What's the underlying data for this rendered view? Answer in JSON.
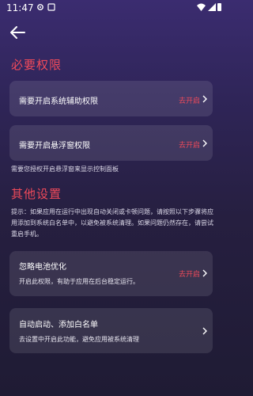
{
  "status": {
    "time": "11:47"
  },
  "header": {
    "back_icon": "arrow-left-icon"
  },
  "required": {
    "title": "必要权限",
    "items": [
      {
        "title": "需要开启系统辅助权限",
        "action": "去开启"
      },
      {
        "title": "需要开启悬浮窗权限",
        "action": "去开启"
      }
    ],
    "note": "需要您授权开启悬浮窗来显示控制面板"
  },
  "other": {
    "title": "其他设置",
    "tip": "提示：如果应用在运行中出现自动关闭或卡顿问题，请按照以下步骤将应用添加到系统白名单中，以避免被系统清理。如果问题仍然存在，请尝试重启手机。",
    "items": [
      {
        "title": "忽略电池优化",
        "desc": "开启此权限，有助于应用在后台稳定运行。",
        "action": "去开启"
      },
      {
        "title": "自动启动、添加白名单",
        "desc": "去设置中开启此功能，避免应用被系统清理",
        "action": ""
      }
    ]
  },
  "colors": {
    "accent": "#f04a5a",
    "bg_top": "#3b2c70",
    "bg_bottom": "#1f1b34"
  }
}
